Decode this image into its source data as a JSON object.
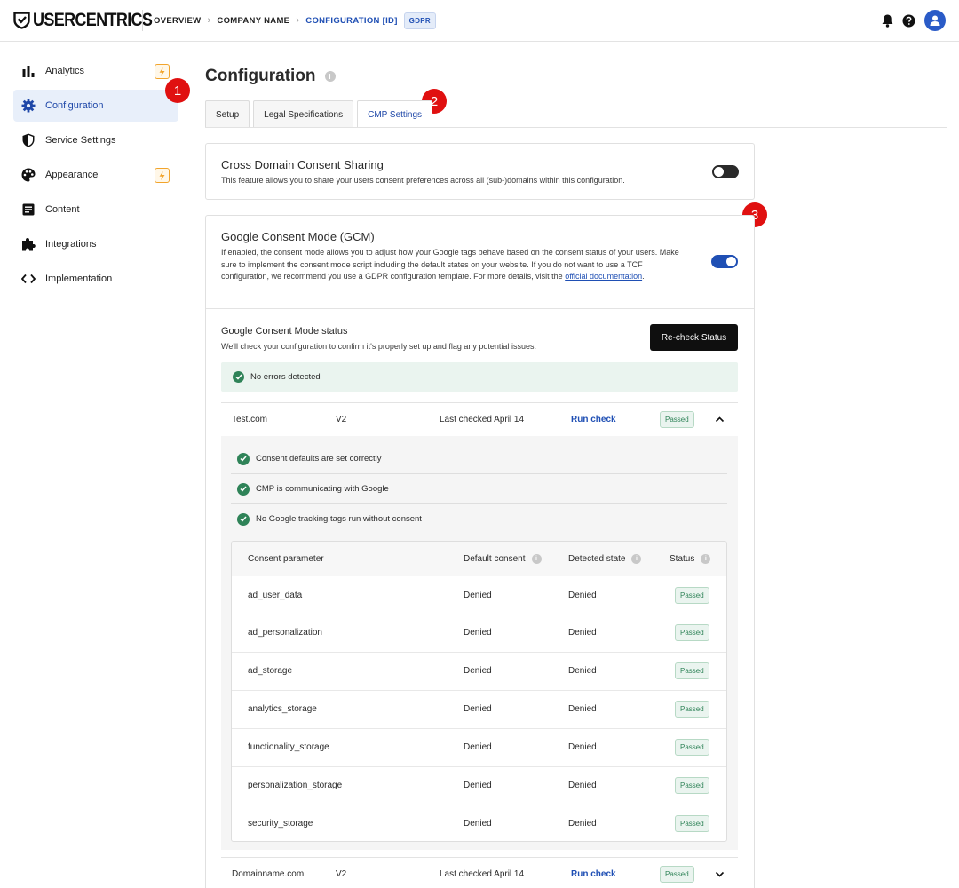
{
  "header": {
    "logo": "USERCENTRICS",
    "breadcrumb": [
      "OVERVIEW",
      "COMPANY NAME",
      "CONFIGURATION [ID]"
    ],
    "tag": "GDPR",
    "icons": [
      "bell-icon",
      "help-icon",
      "user-avatar-icon"
    ]
  },
  "sidebar": {
    "items": [
      {
        "label": "Analytics",
        "icon": "bar-chart-icon",
        "bolt": true
      },
      {
        "label": "Configuration",
        "icon": "gear-icon",
        "active": true
      },
      {
        "label": "Service Settings",
        "icon": "shield-icon"
      },
      {
        "label": "Appearance",
        "icon": "palette-icon",
        "bolt": true
      },
      {
        "label": "Content",
        "icon": "document-icon"
      },
      {
        "label": "Integrations",
        "icon": "puzzle-icon"
      },
      {
        "label": "Implementation",
        "icon": "code-icon"
      }
    ]
  },
  "markers": [
    "1",
    "2",
    "3"
  ],
  "page": {
    "title": "Configuration",
    "tabs": [
      "Setup",
      "Legal Specifications",
      "CMP Settings"
    ],
    "active_tab": "CMP Settings"
  },
  "cross_domain": {
    "title": "Cross Domain Consent Sharing",
    "description": "This feature allows you to share your users consent preferences across all (sub-)domains within this configuration.",
    "enabled": false
  },
  "gcm": {
    "title": "Google Consent Mode (GCM)",
    "description": "If enabled, the consent mode allows you to adjust how your Google tags behave based on the consent status of your users. Make sure to implement the consent mode script including the default states on your website. If you do not want to use a TCF configuration, we recommend you use a GDPR configuration template. For more details, visit the",
    "link_text": "official documentation",
    "after_link": ".",
    "enabled": true,
    "status_title": "Google Consent Mode status",
    "status_desc": "We'll check your configuration to confirm it's properly set up and flag any potential issues.",
    "recheck_label": "Re-check Status",
    "banner": "No errors detected"
  },
  "domains": [
    {
      "name": "Test.com",
      "version": "V2",
      "last_checked": "Last checked April 14",
      "run_check": "Run check",
      "status": "Passed",
      "expanded": true
    },
    {
      "name": "Domainname.com",
      "version": "V2",
      "last_checked": "Last checked April 14",
      "run_check": "Run check",
      "status": "Passed",
      "expanded": false
    }
  ],
  "checks": [
    "Consent defaults are set correctly",
    "CMP is communicating with Google",
    "No Google tracking tags run without consent"
  ],
  "table": {
    "headers": [
      "Consent parameter",
      "Default consent",
      "Detected state",
      "Status"
    ],
    "rows": [
      {
        "param": "ad_user_data",
        "default": "Denied",
        "detected": "Denied",
        "status": "Passed"
      },
      {
        "param": "ad_personalization",
        "default": "Denied",
        "detected": "Denied",
        "status": "Passed"
      },
      {
        "param": "ad_storage",
        "default": "Denied",
        "detected": "Denied",
        "status": "Passed"
      },
      {
        "param": "analytics_storage",
        "default": "Denied",
        "detected": "Denied",
        "status": "Passed"
      },
      {
        "param": "functionality_storage",
        "default": "Denied",
        "detected": "Denied",
        "status": "Passed"
      },
      {
        "param": "personalization_storage",
        "default": "Denied",
        "detected": "Denied",
        "status": "Passed"
      },
      {
        "param": "security_storage",
        "default": "Denied",
        "detected": "Denied",
        "status": "Passed"
      }
    ]
  },
  "colors": {
    "accent": "#1f4fb4",
    "success": "#2f8358",
    "marker": "#e01010",
    "bolt": "#f2a42b"
  }
}
